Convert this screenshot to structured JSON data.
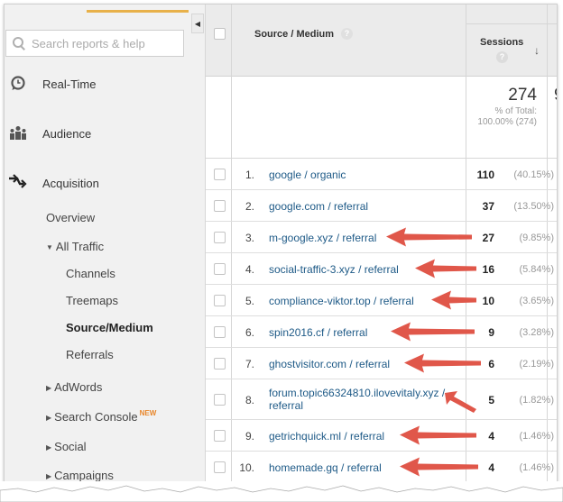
{
  "sidebar": {
    "search_placeholder": "Search reports & help",
    "collapse_icon": "triangle-left",
    "main_items": [
      {
        "label": "Real-Time",
        "icon": "clock-icon"
      },
      {
        "label": "Audience",
        "icon": "people-icon"
      },
      {
        "label": "Acquisition",
        "icon": "arrows-icon"
      }
    ],
    "acquisition": {
      "overview": "Overview",
      "all_traffic": "All Traffic",
      "all_traffic_children": [
        "Channels",
        "Treemaps",
        "Source/Medium",
        "Referrals"
      ],
      "active_child": "Source/Medium",
      "collapsed_groups": [
        {
          "label": "AdWords",
          "badge": ""
        },
        {
          "label": "Search Console",
          "badge": "NEW"
        },
        {
          "label": "Social",
          "badge": ""
        },
        {
          "label": "Campaigns",
          "badge": ""
        }
      ]
    }
  },
  "table": {
    "dimension_header": "Source / Medium",
    "metric_header": "Sessions",
    "help_glyph": "?",
    "sort_glyph": "↓",
    "total": {
      "value": "274",
      "pct_label": "% of Total:",
      "pct_value": "100.00% (274)",
      "next_col_partial": "9"
    },
    "rows": [
      {
        "num": "1.",
        "source": "google / organic",
        "sessions": "110",
        "pct": "(40.15%)",
        "flagged": false
      },
      {
        "num": "2.",
        "source": "google.com / referral",
        "sessions": "37",
        "pct": "(13.50%)",
        "flagged": false
      },
      {
        "num": "3.",
        "source": "m-google.xyz / referral",
        "sessions": "27",
        "pct": "(9.85%)",
        "flagged": true
      },
      {
        "num": "4.",
        "source": "social-traffic-3.xyz / referral",
        "sessions": "16",
        "pct": "(5.84%)",
        "flagged": true
      },
      {
        "num": "5.",
        "source": "compliance-viktor.top / referral",
        "sessions": "10",
        "pct": "(3.65%)",
        "flagged": true
      },
      {
        "num": "6.",
        "source": "spin2016.cf / referral",
        "sessions": "9",
        "pct": "(3.28%)",
        "flagged": true
      },
      {
        "num": "7.",
        "source": "ghostvisitor.com / referral",
        "sessions": "6",
        "pct": "(2.19%)",
        "flagged": true
      },
      {
        "num": "8.",
        "source": "forum.topic66324810.ilovevitaly.xyz / referral",
        "sessions": "5",
        "pct": "(1.82%)",
        "flagged": true
      },
      {
        "num": "9.",
        "source": "getrichquick.ml / referral",
        "sessions": "4",
        "pct": "(1.46%)",
        "flagged": true
      },
      {
        "num": "10.",
        "source": "homemade.gq / referral",
        "sessions": "4",
        "pct": "(1.46%)",
        "flagged": true
      }
    ]
  },
  "annotation_color": "#e0574a",
  "link_color": "#1e5a87",
  "accent_color": "#e8b14a"
}
